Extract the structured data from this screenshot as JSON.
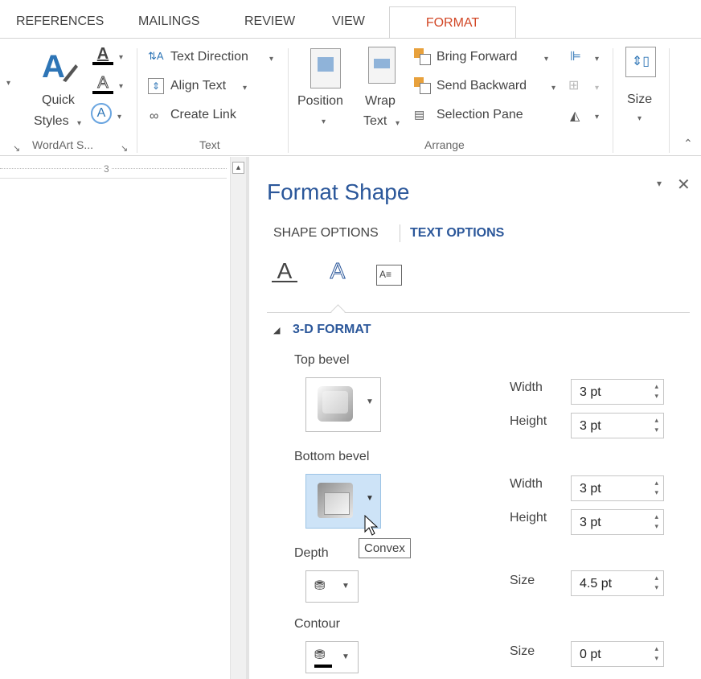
{
  "tabs": [
    "REFERENCES",
    "MAILINGS",
    "REVIEW",
    "VIEW"
  ],
  "active_tab": "FORMAT",
  "ribbon": {
    "quick_styles_1": "Quick",
    "quick_styles_2": "Styles",
    "wordart_group": "WordArt S...",
    "text_direction": "Text Direction",
    "align_text": "Align Text",
    "create_link": "Create Link",
    "text_group": "Text",
    "position": "Position",
    "wrap_1": "Wrap",
    "wrap_2": "Text",
    "bring_forward": "Bring Forward",
    "send_backward": "Send Backward",
    "selection_pane": "Selection Pane",
    "arrange_group": "Arrange",
    "size": "Size"
  },
  "ruler": {
    "mark": "3"
  },
  "pane": {
    "title": "Format Shape",
    "tab_shape": "SHAPE OPTIONS",
    "tab_text": "TEXT OPTIONS",
    "section": "3-D FORMAT",
    "top_bevel": "Top bevel",
    "bottom_bevel": "Bottom bevel",
    "depth": "Depth",
    "contour": "Contour",
    "width_label": "Width",
    "height_label": "Height",
    "size_label": "Size",
    "top_width": "3 pt",
    "top_height": "3 pt",
    "bottom_width": "3 pt",
    "bottom_height": "3 pt",
    "depth_size": "4.5 pt",
    "contour_size": "0 pt",
    "tooltip": "Convex"
  },
  "colors": {
    "accent": "#d24726",
    "pane_blue": "#2b579a",
    "active_tile": "#cde3f7"
  }
}
